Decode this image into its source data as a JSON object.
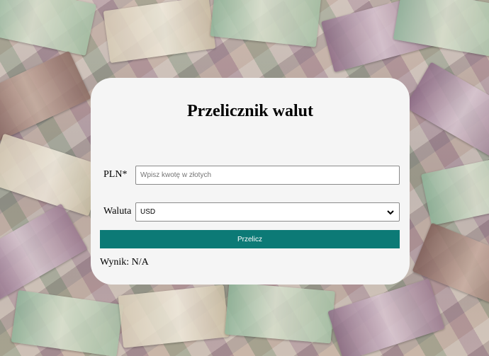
{
  "app": {
    "title": "Przelicznik walut"
  },
  "form": {
    "pln_label": "PLN*",
    "pln_placeholder": "Wpisz kwotę w złotych",
    "pln_value": "",
    "currency_label": "Waluta",
    "currency_selected": "USD",
    "convert_button": "Przelicz"
  },
  "result": {
    "label": "Wynik: N/A"
  },
  "colors": {
    "button": "#0c7a76",
    "card": "#f5f5f5"
  },
  "icons": {
    "select_arrow": "chevron-down-icon"
  }
}
